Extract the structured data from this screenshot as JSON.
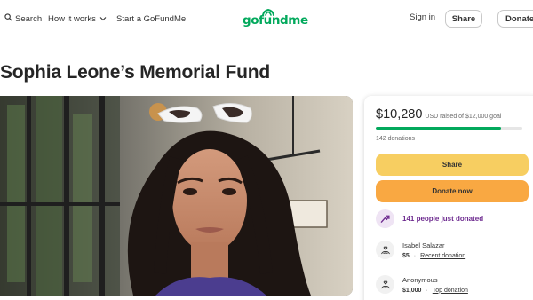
{
  "header": {
    "search_label": "Search",
    "how_it_works_label": "How it works",
    "start_label": "Start a GoFundMe",
    "logo_text": "gofundme",
    "signin_label": "Sign in",
    "share_label": "Share",
    "donate_label": "Donate"
  },
  "campaign": {
    "title": "Sophia Leone’s Memorial Fund"
  },
  "donation_card": {
    "raised_amount": "$10,280",
    "raised_label": "USD raised of $12,000 goal",
    "progress_fraction": 0.857,
    "donation_count": "142 donations",
    "share_label": "Share",
    "donate_label": "Donate now",
    "activity_text": "141 people just donated",
    "donors": [
      {
        "name": "Isabel Salazar",
        "amount": "$5",
        "tag": "Recent donation"
      },
      {
        "name": "Anonymous",
        "amount": "$1,000",
        "tag": "Top donation"
      }
    ]
  },
  "colors": {
    "brand_green": "#02a95c",
    "share_yellow": "#f7ce61",
    "donate_orange": "#f9a842",
    "activity_purple": "#6d2a8f"
  },
  "icons": [
    "search-icon",
    "chevron-down-icon",
    "trend-up-icon",
    "donation-hands-icon"
  ]
}
